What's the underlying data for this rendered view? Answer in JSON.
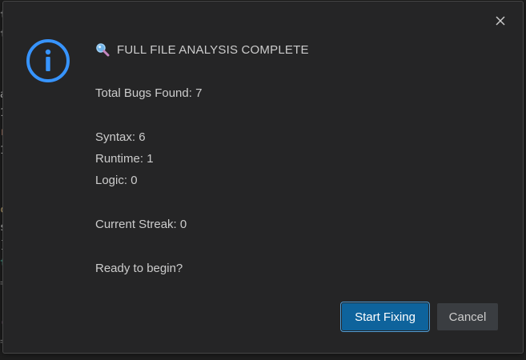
{
  "dialog": {
    "close_glyph": "✕",
    "title": "FULL FILE ANALYSIS COMPLETE",
    "title_icon": "magnifier-icon",
    "status_icon": "info-icon",
    "total": "Total Bugs Found: 7",
    "syntax": "Syntax: 6",
    "runtime": "Runtime: 1",
    "logic": "Logic: 0",
    "streak": "Current Streak: 0",
    "prompt": "Ready to begin?",
    "primary_button": "Start Fixing",
    "secondary_button": "Cancel"
  },
  "background_editor": {
    "glyphs": [
      "t",
      "t",
      "a",
      "1",
      "r",
      "1",
      "c",
      "s",
      "]",
      "t",
      "=",
      "(",
      "="
    ]
  },
  "colors": {
    "accent": "#0e639c",
    "icon_blue": "#3794ff",
    "dialog_bg": "#252526",
    "text": "#cccccc"
  }
}
